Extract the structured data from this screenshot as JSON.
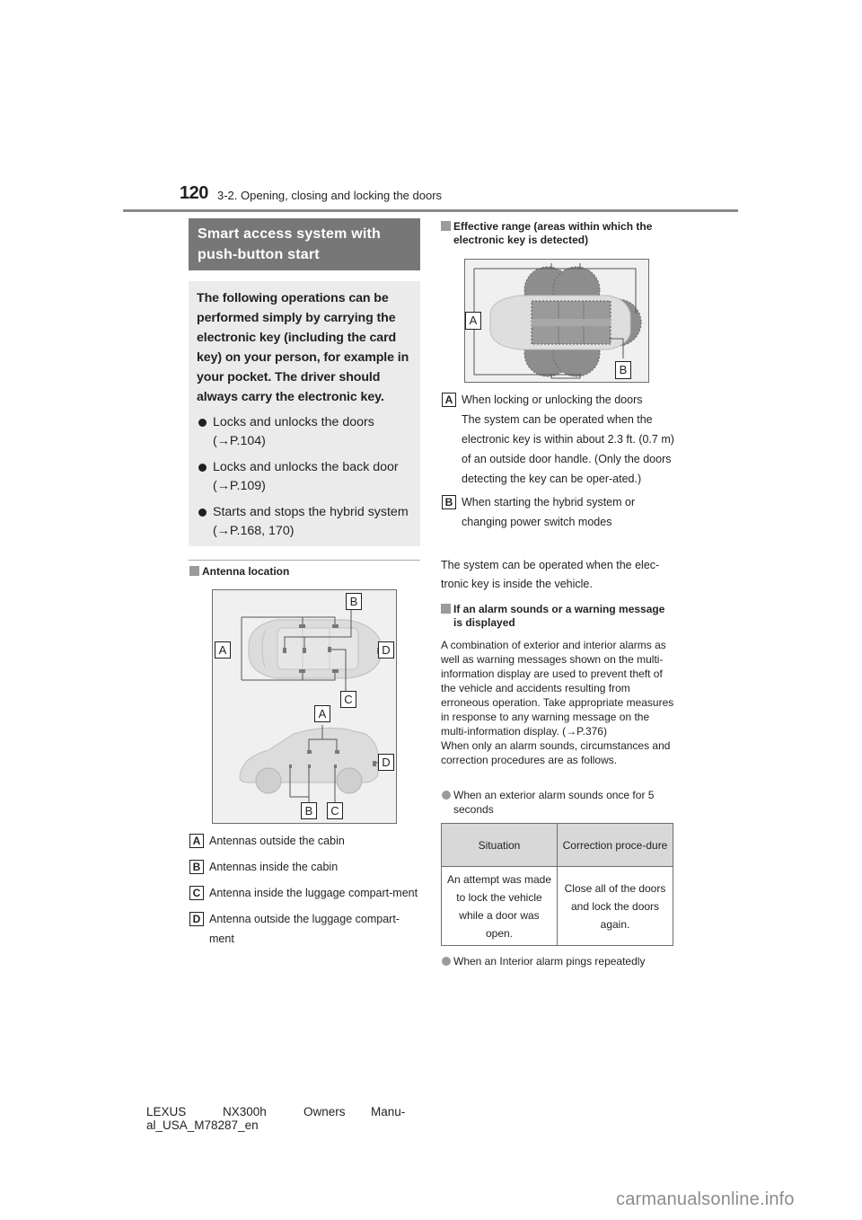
{
  "header": {
    "page_number": "120",
    "section": "3-2. Opening, closing and locking the doors"
  },
  "title_bar": {
    "line1": "Smart access system with",
    "line2": "push-button start"
  },
  "intro": {
    "text": "The following operations can be performed simply by carrying the electronic key (including the card key) on your person, for example in your pocket. The driver should always carry the electronic key.",
    "bullets": [
      {
        "text": "Locks and unlocks the doors",
        "ref": "(→P.104)"
      },
      {
        "text": "Locks and unlocks the back door",
        "ref": "(→P.109)"
      },
      {
        "text": "Starts and stops the hybrid system",
        "ref": "(→P.168, 170)"
      }
    ]
  },
  "antenna_section": {
    "heading": "Antenna location",
    "diagram_labels": {
      "a": "A",
      "b": "B",
      "c": "C",
      "d": "D"
    },
    "legend": [
      {
        "badge": "A",
        "text": "Antennas outside the cabin"
      },
      {
        "badge": "B",
        "text": "Antennas inside the cabin"
      },
      {
        "badge": "C",
        "text": "Antenna inside the luggage compart-ment"
      },
      {
        "badge": "D",
        "text": "Antenna outside the luggage compart-ment"
      }
    ]
  },
  "range_section": {
    "heading_line1": "Effective range (areas within which the",
    "heading_line2": "electronic key is detected)",
    "diagram_labels": {
      "a": "A",
      "b": "B"
    },
    "items": [
      {
        "badge": "A",
        "title": "When locking or unlocking the doors",
        "detail": "The system can be operated when the electronic key is within about 2.3 ft. (0.7 m) of an outside door handle. (Only the doors detecting the key can be oper-ated.)"
      },
      {
        "badge": "B",
        "title": "When starting the hybrid system or changing power switch modes",
        "detail": ""
      }
    ],
    "note": "The system can be operated when the elec-tronic key is inside the vehicle."
  },
  "alarm_section": {
    "heading_line1": "If an alarm sounds or a warning message",
    "heading_line2": "is displayed",
    "paragraph1": "A combination of exterior and interior alarms as well as warning messages shown on the multi-information display are used to prevent theft of the vehicle and accidents resulting from erroneous operation. Take appropriate measures in response to any warning message on the multi-information display. (→P.376)",
    "paragraph2": "When only an alarm sounds, circumstances and correction procedures are as follows.",
    "case1": "When an exterior alarm sounds once for 5 seconds",
    "table": {
      "headers": [
        "Situation",
        "Correction proce-dure"
      ],
      "rows": [
        [
          "An attempt was made to lock the vehicle while a door was open.",
          "Close all of the doors and lock the doors again."
        ]
      ]
    },
    "case2": "When an Interior alarm pings repeatedly"
  },
  "footer": {
    "w1": "LEXUS",
    "w2": "NX300h",
    "w3": "Owners",
    "w4": "Manu-",
    "line2": "al_USA_M78287_en"
  },
  "watermark": "carmanualsonline.info"
}
